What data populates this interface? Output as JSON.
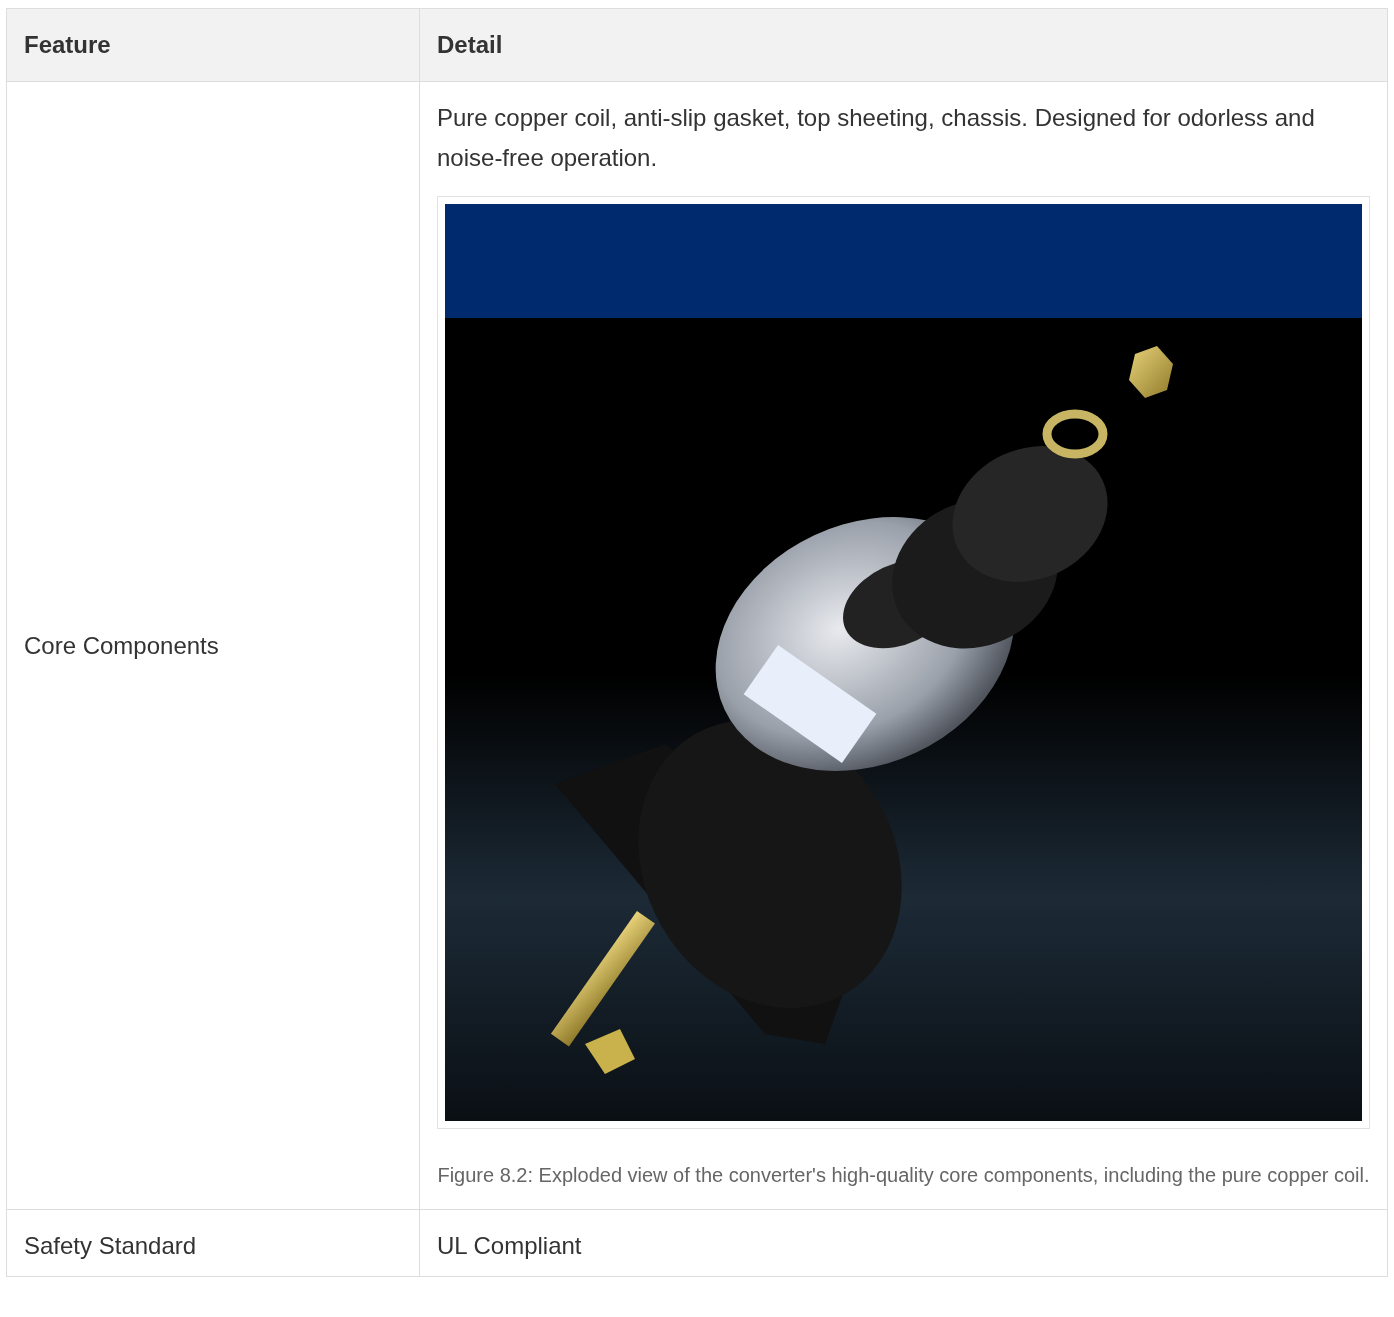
{
  "table": {
    "columns": [
      "Feature",
      "Detail"
    ],
    "rows": [
      {
        "feature": "Core Components",
        "detail": "Pure copper coil, anti-slip gasket, top sheeting, chassis. Designed for odorless and noise-free operation.",
        "figure": {
          "kind": "picture",
          "caption": "Figure 8.2: Exploded view of the converter's high-quality core components, including the pure copper coil."
        }
      },
      {
        "feature": "Safety Standard",
        "detail": "UL Compliant"
      }
    ]
  }
}
